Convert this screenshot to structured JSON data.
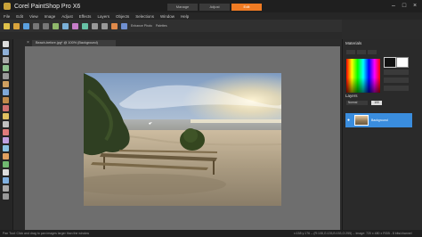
{
  "window": {
    "title": "Corel PaintShop Pro X6",
    "modes": [
      "Manage",
      "Adjust",
      "Edit"
    ],
    "active_mode": "Edit"
  },
  "menu": [
    "File",
    "Edit",
    "View",
    "Image",
    "Adjust",
    "Effects",
    "Layers",
    "Objects",
    "Selections",
    "Window",
    "Help"
  ],
  "toolbar": {
    "enhance_label": "Enhance Photo",
    "palettes_label": "Palettes"
  },
  "document": {
    "tab_title": "Beach-before.jpg* @ 100% (Background)"
  },
  "panels": {
    "materials_title": "Materials",
    "layers_title": "Layers",
    "blend_mode": "Normal",
    "opacity": "100",
    "layer_name": "Background"
  },
  "status": {
    "left": "Pan Tool: Click and drag to pan images larger than the window",
    "right": "x:158 y:176 -- (R:108,G:135,B:153,O:255) -- Image: 720 x 480 x RGB - 8 bits/channel"
  },
  "colors": {
    "accent": "#f07b23",
    "selection": "#3a8dde"
  }
}
